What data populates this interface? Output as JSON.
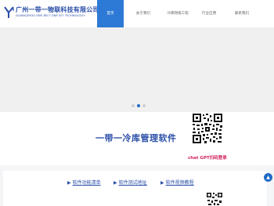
{
  "brand": {
    "title": "广州一带一物联科技有限公司",
    "subtitle": "GUANGZHOU ONE BELT ONE IOT TECHNOLOGY",
    "logo_icon": "yb-logo-icon"
  },
  "nav": {
    "items": [
      {
        "label": "首页",
        "active": true
      },
      {
        "label": "关于我们",
        "active": false
      },
      {
        "label": "冷库网络工程",
        "active": false
      },
      {
        "label": "行业应用",
        "active": false
      },
      {
        "label": "联系我们",
        "active": false
      }
    ]
  },
  "carousel": {
    "dots": 3,
    "active_index": 1
  },
  "promo": {
    "heading": "一带一冷库管理软件",
    "qr_caption": "chat GPT扫码登录"
  },
  "links": [
    {
      "label": "软件功能清单",
      "icon": "arrow-icon"
    },
    {
      "label": "软件测试地址",
      "icon": "arrow-icon"
    },
    {
      "label": "软件视频教程",
      "icon": "arrow-icon"
    }
  ],
  "colors": {
    "brand": "#2a4ea8",
    "nav_active": "#2d79d6",
    "caption": "#d0205a"
  }
}
